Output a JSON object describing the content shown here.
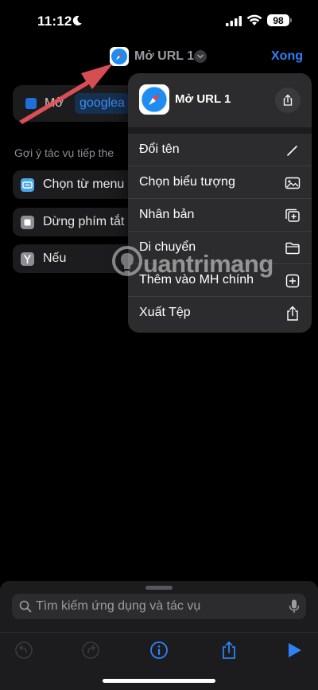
{
  "status": {
    "time": "11:12",
    "battery": "98"
  },
  "nav": {
    "title": "Mở URL 1",
    "done_label": "Xong"
  },
  "editor": {
    "action_verb": "Mở",
    "action_param": "googlea",
    "suggestions_header": "Gợi ý tác vụ tiếp the",
    "suggestions": [
      {
        "label": "Chọn từ menu",
        "icon": "menu-icon",
        "color": "#4aa8e8"
      },
      {
        "label": "Dừng phím tắt",
        "icon": "stop-icon",
        "color": "#8e8e93"
      },
      {
        "label": "Nếu",
        "icon": "branch-icon",
        "color": "#8e8e93"
      }
    ]
  },
  "menu": {
    "title": "Mở URL 1",
    "items": [
      {
        "label": "Đổi tên",
        "icon": "pencil-icon"
      },
      {
        "label": "Chọn biểu tượng",
        "icon": "image-icon"
      },
      {
        "label": "Nhân bản",
        "icon": "duplicate-icon"
      },
      {
        "label": "Di chuyển",
        "icon": "folder-icon"
      },
      {
        "label": "Thêm vào MH chính",
        "icon": "add-square-icon"
      },
      {
        "label": "Xuất Tệp",
        "icon": "export-icon"
      }
    ]
  },
  "watermark": {
    "text": "uantrimang"
  },
  "search": {
    "placeholder": "Tìm kiếm ứng dụng và tác vụ"
  },
  "colors": {
    "accent": "#2f81f7",
    "arrow": "#e8545a"
  }
}
